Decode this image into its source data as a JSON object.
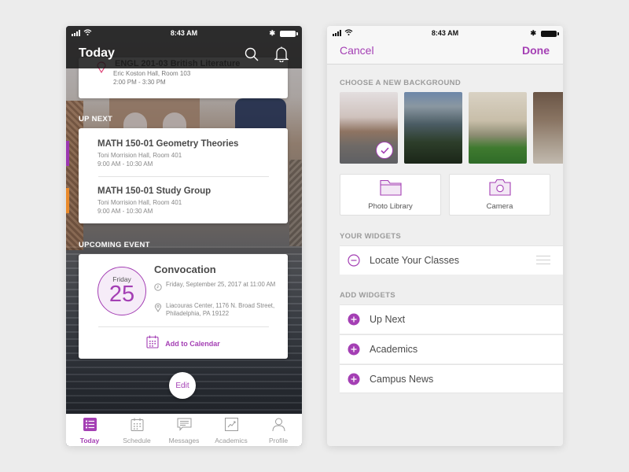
{
  "status_bar": {
    "time": "8:43 AM"
  },
  "today_screen": {
    "title": "Today",
    "icons": [
      "search-icon",
      "bell-icon"
    ],
    "current_class": {
      "title": "ENGL 201-03 British Literature",
      "location": "Eric Koston Hall, Room 103",
      "time": "2:00 PM - 3:30 PM"
    },
    "up_next": {
      "label": "UP NEXT",
      "items": [
        {
          "title": "MATH 150-01 Geometry Theories",
          "location": "Toni Morrision Hall, Room 401",
          "time": "9:00 AM - 10:30 AM",
          "color": "#9b36b0"
        },
        {
          "title": "MATH 150-01 Study Group",
          "location": "Toni Morrision Hall, Room 401",
          "time": "9:00 AM - 10:30 AM",
          "color": "#ea8a2a"
        }
      ]
    },
    "upcoming_event": {
      "label": "UPCOMING EVENT",
      "day_name": "Friday",
      "day_number": "25",
      "title": "Convocation",
      "datetime": "Friday, September 25, 2017 at 11:00 AM",
      "location": "Liacouras Center, 1176 N. Broad Street, Philadelphia, PA 19122",
      "action": "Add to Calendar"
    },
    "edit_label": "Edit",
    "tabs": [
      {
        "label": "Today",
        "icon": "list-icon",
        "active": true
      },
      {
        "label": "Schedule",
        "icon": "calendar-icon",
        "active": false
      },
      {
        "label": "Messages",
        "icon": "message-icon",
        "active": false
      },
      {
        "label": "Academics",
        "icon": "chart-icon",
        "active": false
      },
      {
        "label": "Profile",
        "icon": "person-icon",
        "active": false
      }
    ]
  },
  "edit_screen": {
    "cancel_label": "Cancel",
    "done_label": "Done",
    "background_section": "CHOOSE A NEW BACKGROUND",
    "backgrounds": [
      {
        "name": "Bridge with runner",
        "selected": true
      },
      {
        "name": "Campus at dusk",
        "selected": false
      },
      {
        "name": "Library lawn",
        "selected": false
      },
      {
        "name": "Stone archway",
        "selected": false
      }
    ],
    "sources": [
      {
        "label": "Photo Library",
        "icon": "folder-icon"
      },
      {
        "label": "Camera",
        "icon": "camera-icon"
      }
    ],
    "your_widgets_label": "YOUR WIDGETS",
    "your_widgets": [
      {
        "label": "Locate Your Classes"
      }
    ],
    "add_widgets_label": "ADD WIDGETS",
    "add_widgets": [
      {
        "label": "Up Next"
      },
      {
        "label": "Academics"
      },
      {
        "label": "Campus News"
      }
    ]
  },
  "colors": {
    "accent": "#a43fb4",
    "accent_orange": "#ea8a2a",
    "page_bg": "#ececec"
  }
}
